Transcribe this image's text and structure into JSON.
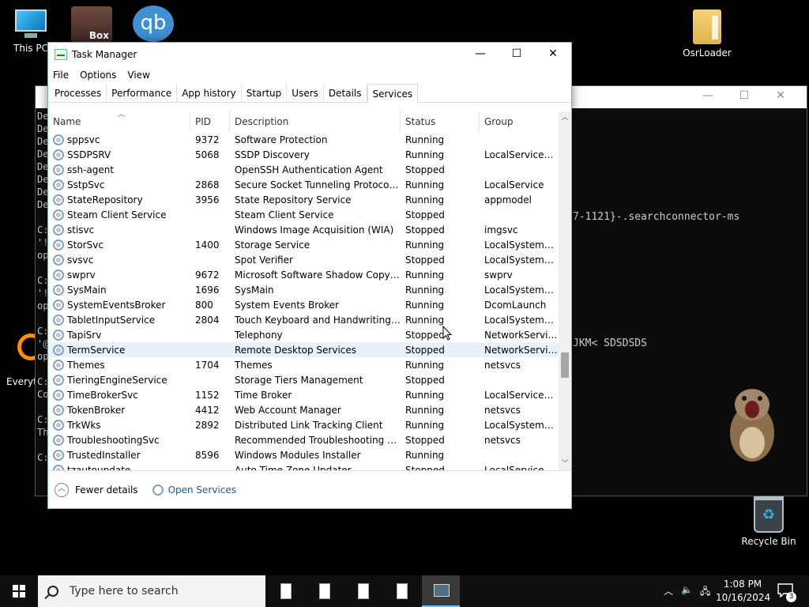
{
  "desktop": {
    "icons": {
      "this_pc": "This PC",
      "osrloader": "OsrLoader",
      "recycle_bin": "Recycle Bin",
      "everything": "Everyth",
      "box_app": "Box",
      "qb_app": "qb"
    }
  },
  "console": {
    "left_lines": [
      "De",
      "De",
      "De",
      "De",
      "De",
      "De",
      "De",
      "De",
      "",
      "C:",
      "'!",
      "op",
      "",
      "C:",
      "'!",
      "op",
      "",
      "C:",
      "'@",
      "op",
      "",
      "C:",
      "Co",
      "",
      "C:",
      "Th",
      "",
      "C:"
    ],
    "right_line_1": "7-1121}-.searchconnector-ms",
    "right_line_2": "JKM< SDSDSDS"
  },
  "task_manager": {
    "title": "Task Manager",
    "menu": [
      "File",
      "Options",
      "View"
    ],
    "tabs": [
      "Processes",
      "Performance",
      "App history",
      "Startup",
      "Users",
      "Details",
      "Services"
    ],
    "active_tab": "Services",
    "columns": {
      "name": "Name",
      "pid": "PID",
      "description": "Description",
      "status": "Status",
      "group": "Group"
    },
    "rows": [
      {
        "name": "sppsvc",
        "pid": "9372",
        "description": "Software Protection",
        "status": "Running",
        "group": ""
      },
      {
        "name": "SSDPSRV",
        "pid": "5068",
        "description": "SSDP Discovery",
        "status": "Running",
        "group": "LocalServiceA..."
      },
      {
        "name": "ssh-agent",
        "pid": "",
        "description": "OpenSSH Authentication Agent",
        "status": "Stopped",
        "group": ""
      },
      {
        "name": "SstpSvc",
        "pid": "2868",
        "description": "Secure Socket Tunneling Protocol Se...",
        "status": "Running",
        "group": "LocalService"
      },
      {
        "name": "StateRepository",
        "pid": "3956",
        "description": "State Repository Service",
        "status": "Running",
        "group": "appmodel"
      },
      {
        "name": "Steam Client Service",
        "pid": "",
        "description": "Steam Client Service",
        "status": "Stopped",
        "group": ""
      },
      {
        "name": "stisvc",
        "pid": "",
        "description": "Windows Image Acquisition (WIA)",
        "status": "Stopped",
        "group": "imgsvc"
      },
      {
        "name": "StorSvc",
        "pid": "1400",
        "description": "Storage Service",
        "status": "Running",
        "group": "LocalSystemN..."
      },
      {
        "name": "svsvc",
        "pid": "",
        "description": "Spot Verifier",
        "status": "Stopped",
        "group": "LocalSystemN..."
      },
      {
        "name": "swprv",
        "pid": "9672",
        "description": "Microsoft Software Shadow Copy Pr...",
        "status": "Running",
        "group": "swprv"
      },
      {
        "name": "SysMain",
        "pid": "1696",
        "description": "SysMain",
        "status": "Running",
        "group": "LocalSystemN..."
      },
      {
        "name": "SystemEventsBroker",
        "pid": "800",
        "description": "System Events Broker",
        "status": "Running",
        "group": "DcomLaunch"
      },
      {
        "name": "TabletInputService",
        "pid": "2804",
        "description": "Touch Keyboard and Handwriting Pa...",
        "status": "Running",
        "group": "LocalSystemN..."
      },
      {
        "name": "TapiSrv",
        "pid": "",
        "description": "Telephony",
        "status": "Stopped",
        "group": "NetworkService"
      },
      {
        "name": "TermService",
        "pid": "",
        "description": "Remote Desktop Services",
        "status": "Stopped",
        "group": "NetworkService"
      },
      {
        "name": "Themes",
        "pid": "1704",
        "description": "Themes",
        "status": "Running",
        "group": "netsvcs"
      },
      {
        "name": "TieringEngineService",
        "pid": "",
        "description": "Storage Tiers Management",
        "status": "Stopped",
        "group": ""
      },
      {
        "name": "TimeBrokerSvc",
        "pid": "1152",
        "description": "Time Broker",
        "status": "Running",
        "group": "LocalServiceN..."
      },
      {
        "name": "TokenBroker",
        "pid": "4412",
        "description": "Web Account Manager",
        "status": "Running",
        "group": "netsvcs"
      },
      {
        "name": "TrkWks",
        "pid": "2892",
        "description": "Distributed Link Tracking Client",
        "status": "Running",
        "group": "LocalSystemN..."
      },
      {
        "name": "TroubleshootingSvc",
        "pid": "",
        "description": "Recommended Troubleshooting Ser...",
        "status": "Stopped",
        "group": "netsvcs"
      },
      {
        "name": "TrustedInstaller",
        "pid": "8596",
        "description": "Windows Modules Installer",
        "status": "Running",
        "group": ""
      },
      {
        "name": "tzautoupdate",
        "pid": "",
        "description": "Auto Time Zone Updater",
        "status": "Stopped",
        "group": "LocalService"
      }
    ],
    "selected_row": "TermService",
    "footer": {
      "fewer_details": "Fewer details",
      "open_services": "Open Services"
    }
  },
  "taskbar": {
    "search_placeholder": "Type here to search",
    "time": "1:08 PM",
    "date": "10/16/2024",
    "notification_count": "3"
  }
}
